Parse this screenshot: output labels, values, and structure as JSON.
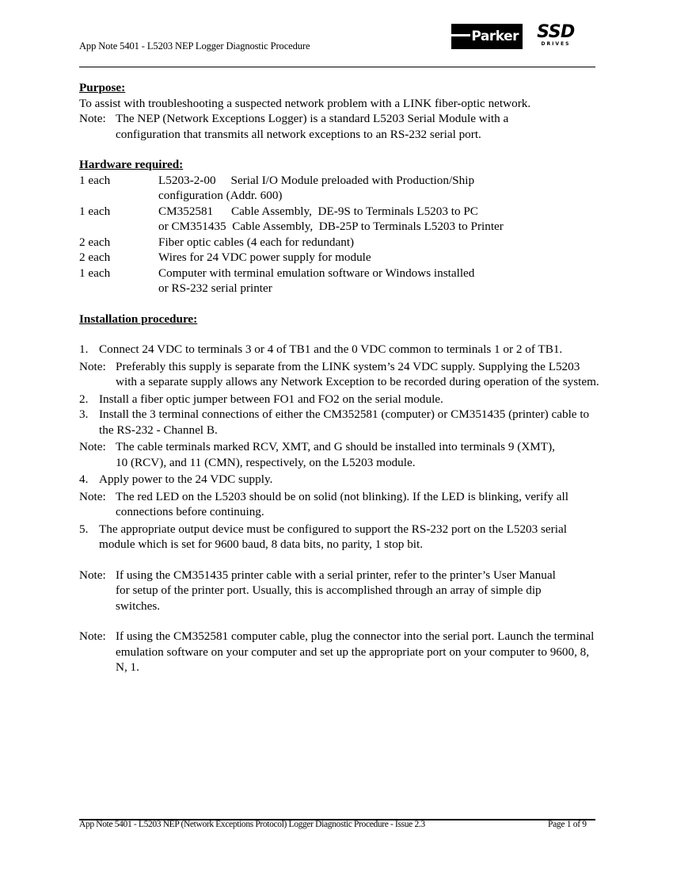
{
  "header": {
    "title": "App Note 5401 -  L5203 NEP  Logger Diagnostic Procedure",
    "logos": {
      "parker": "Parker",
      "ssd": "SSD",
      "ssd_sub": "DRIVES"
    }
  },
  "purpose": {
    "heading": "Purpose:",
    "text": "To assist with troubleshooting a suspected network problem with a LINK fiber-optic network.",
    "note_label": "Note:",
    "note_line1": "The NEP (Network Exceptions Logger) is a standard L5203 Serial Module with a",
    "note_line2": "configuration that transmits all network exceptions to an RS-232 serial port."
  },
  "hardware": {
    "heading": "Hardware required:",
    "items": [
      {
        "qty": "1 each",
        "lines": [
          "L5203-2-00     Serial I/O Module preloaded with Production/Ship",
          "configuration (Addr. 600)"
        ]
      },
      {
        "qty": "1 each",
        "lines": [
          "CM352581      Cable Assembly,  DE-9S to Terminals L5203 to PC",
          "or CM351435  Cable Assembly,  DB-25P to Terminals L5203 to Printer"
        ]
      },
      {
        "qty": "2 each",
        "lines": [
          "Fiber optic cables (4 each for redundant)"
        ]
      },
      {
        "qty": "2 each",
        "lines": [
          "Wires for 24 VDC power supply for module"
        ]
      },
      {
        "qty": "1 each",
        "lines": [
          "Computer with terminal emulation software or Windows installed",
          "or RS-232 serial printer"
        ]
      }
    ]
  },
  "installation": {
    "heading": "Installation procedure:",
    "blocks": [
      {
        "type": "step",
        "label": "1.",
        "text": "Connect 24 VDC to terminals 3 or 4 of TB1 and the 0 VDC common to terminals 1 or 2 of TB1."
      },
      {
        "type": "note",
        "label": "Note:",
        "text": "Preferably this supply is separate from the LINK system’s 24 VDC supply. Supplying the L5203 with a separate supply allows any Network Exception to be recorded during operation of the system."
      },
      {
        "type": "step",
        "label": "2.",
        "text": "Install a fiber optic jumper between FO1 and FO2 on the serial module."
      },
      {
        "type": "step",
        "label": "3.",
        "text": "Install the 3 terminal connections of either the CM352581 (computer) or CM351435 (printer) cable to the RS-232 - Channel B."
      },
      {
        "type": "note",
        "label": "Note:",
        "text": "The cable terminals marked RCV, XMT, and G should be installed into terminals 9 (XMT), 10 (RCV), and 11 (CMN), respectively, on the L5203 module."
      },
      {
        "type": "step",
        "label": "4.",
        "text": "Apply power to the 24 VDC supply."
      },
      {
        "type": "note",
        "label": "Note:",
        "text": "The red LED on the L5203 should be on solid (not blinking).  If the LED is blinking, verify all connections before continuing."
      },
      {
        "type": "step",
        "label": "5.",
        "text": "The appropriate output device must be configured to support the RS-232 port on the L5203 serial module which is set for 9600 baud, 8 data bits,  no parity, 1 stop bit."
      },
      {
        "type": "note",
        "label": "Note:",
        "text": "If using the CM351435 printer cable with a serial printer, refer to the printer’s User Manual for setup of the printer port.  Usually, this is accomplished through an array of simple dip switches."
      },
      {
        "type": "note",
        "label": "Note:",
        "text": "If using the CM352581 computer cable, plug the connector into the serial port.  Launch the terminal emulation software on your computer and set up the appropriate port on your computer to 9600, 8, N, 1."
      }
    ]
  },
  "footer": {
    "left": "App Note 5401 - L5203 NEP (Network Exceptions Protocol)  Logger Diagnostic Procedure  - Issue 2.3",
    "right": "Page 1 of 9"
  }
}
